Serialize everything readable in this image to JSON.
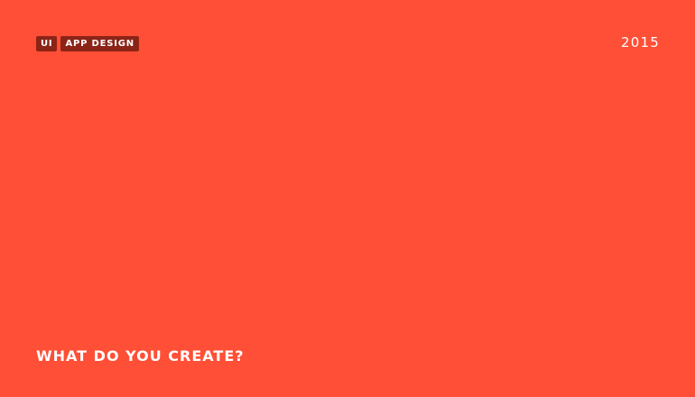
{
  "tags": [
    "UI",
    "APP DESIGN"
  ],
  "year": "2015",
  "headline": "WHAT DO YOU CREATE?",
  "colors": {
    "background": "#ff4f36",
    "tag_background": "#8b2417",
    "text": "#ffffff"
  }
}
